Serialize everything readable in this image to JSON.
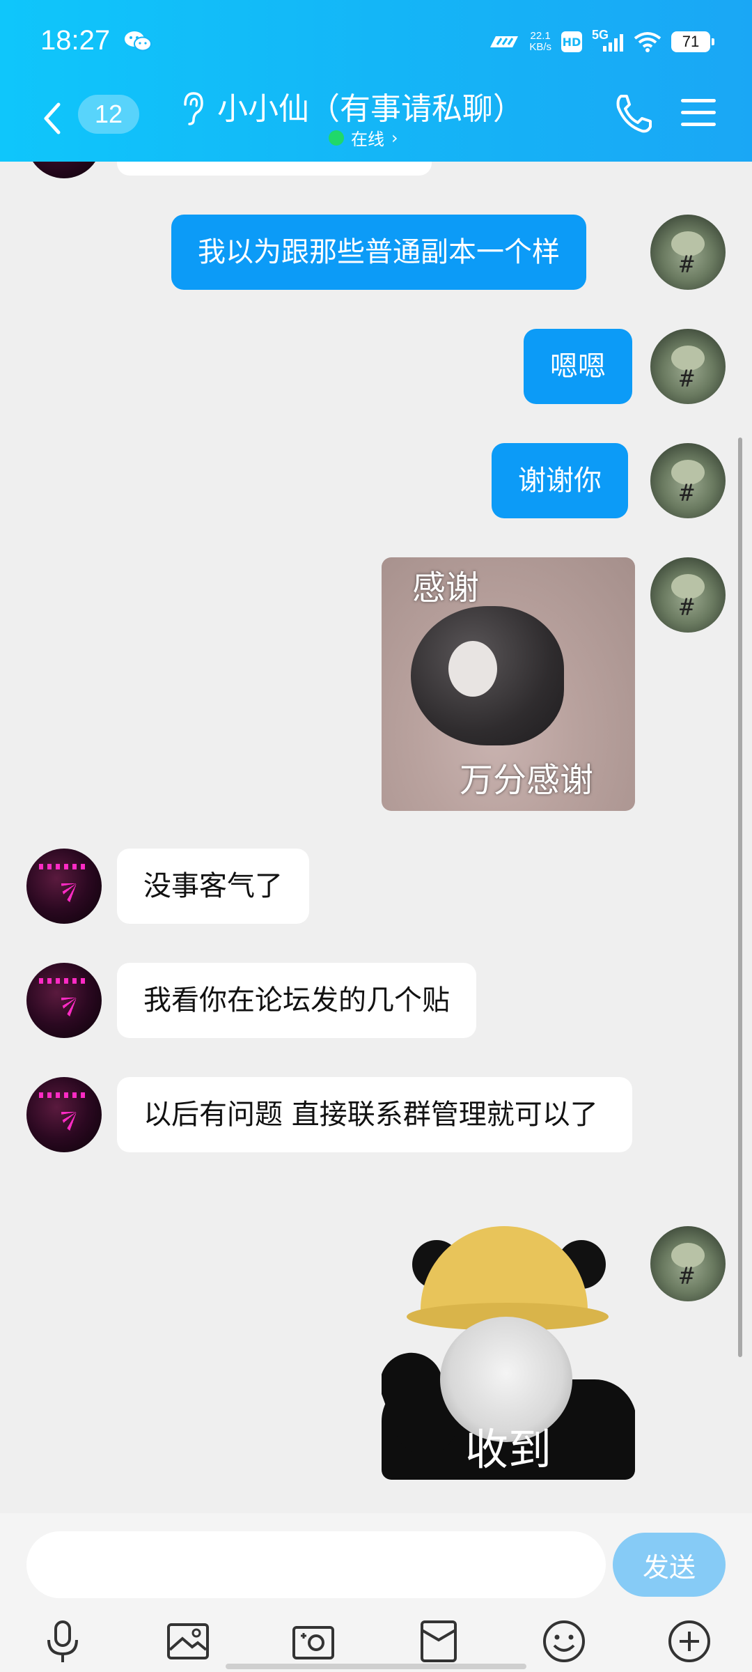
{
  "status_bar": {
    "time": "18:27",
    "network_speed": "22.1",
    "network_speed_unit": "KB/s",
    "hd_label": "HD",
    "network_type": "5G",
    "battery": "71",
    "notification_icon": "wechat-icon"
  },
  "header": {
    "unread_count": "12",
    "contact_name": "小小仙（有事请私聊）",
    "presence": "在线",
    "presence_arrow": "›",
    "icons": [
      "back-icon",
      "ear-icon",
      "phone-icon",
      "menu-icon"
    ]
  },
  "messages": [
    {
      "sender": "me",
      "type": "text",
      "text": "我以为跟那些普通副本一个样"
    },
    {
      "sender": "me",
      "type": "text",
      "text": "嗯嗯"
    },
    {
      "sender": "me",
      "type": "text",
      "text": "谢谢你"
    },
    {
      "sender": "me",
      "type": "sticker",
      "caption_top": "感谢",
      "caption_bottom": "万分感谢"
    },
    {
      "sender": "them",
      "type": "text",
      "text": "没事客气了"
    },
    {
      "sender": "them",
      "type": "text",
      "text": "我看你在论坛发的几个贴"
    },
    {
      "sender": "them",
      "type": "text",
      "text": "以后有问题 直接联系群管理就可以了"
    },
    {
      "sender": "me",
      "type": "sticker",
      "caption_bottom": "收到"
    }
  ],
  "input": {
    "value": "",
    "send_label": "发送"
  },
  "toolbar": {
    "icons": [
      "microphone-icon",
      "image-icon",
      "camera-icon",
      "red-packet-icon",
      "emoji-icon",
      "plus-icon"
    ]
  },
  "colors": {
    "header_start": "#0fc6fb",
    "header_end": "#1aa7f5",
    "my_bubble": "#0c9bf7",
    "their_bubble": "#ffffff",
    "chat_background": "#efefef",
    "send_button": "#86cbf6",
    "online_dot": "#20d86a"
  }
}
